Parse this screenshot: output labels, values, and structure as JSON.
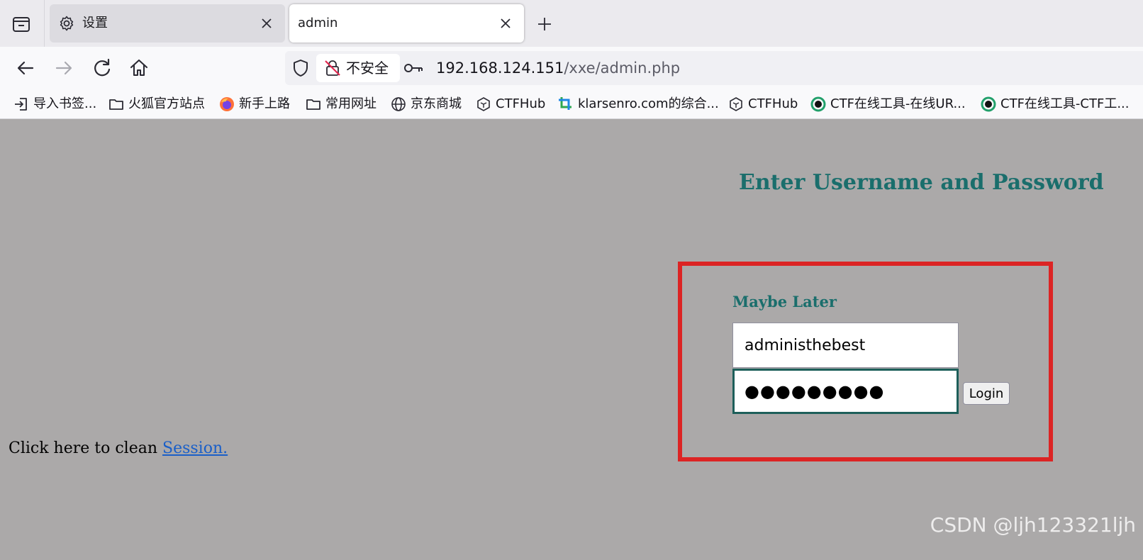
{
  "tabs": [
    {
      "label": "设置",
      "icon": "gear-icon"
    },
    {
      "label": "admin",
      "icon": ""
    }
  ],
  "navigation": {
    "security_label": "不安全",
    "url_host": "192.168.124.151",
    "url_path": "/xxe/admin.php"
  },
  "bookmarks": [
    {
      "label": "导入书签...",
      "icon": "import-icon"
    },
    {
      "label": "火狐官方站点",
      "icon": "folder-icon"
    },
    {
      "label": "新手上路",
      "icon": "firefox-icon"
    },
    {
      "label": "常用网址",
      "icon": "folder-icon"
    },
    {
      "label": "京东商城",
      "icon": "globe-icon"
    },
    {
      "label": "CTFHub",
      "icon": "ctfhub-icon"
    },
    {
      "label": "klarsenro.com的综合...",
      "icon": "crop-icon"
    },
    {
      "label": "CTFHub",
      "icon": "ctfhub-icon"
    },
    {
      "label": "CTF在线工具-在线UR...",
      "icon": "ctf-tool-icon"
    },
    {
      "label": "CTF在线工具-CTF工...",
      "icon": "ctf-tool-icon"
    }
  ],
  "page": {
    "heading": "Enter Username and Password",
    "maybe_later": "Maybe Later",
    "username_value": "administhebest",
    "password_masked": "●●●●●●●●●",
    "login_button": "Login",
    "clean_text": "Click here to clean ",
    "session_link": "Session."
  },
  "watermark": "CSDN @ljh123321ljh",
  "colors": {
    "page_background": "#aba9a9",
    "heading_color": "#1a6e6c",
    "highlight_border": "#dc2424",
    "link_color": "#1a5fc8"
  }
}
